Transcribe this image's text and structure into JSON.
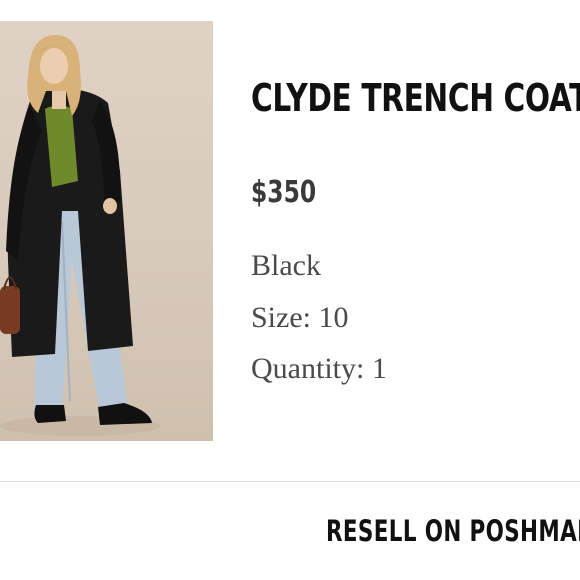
{
  "product": {
    "title": "CLYDE TRENCH COAT",
    "price": "$350",
    "color": "Black",
    "size": "Size: 10",
    "quantity": "Quantity: 1",
    "image_icon": "product-photo"
  },
  "actions": {
    "resell_label": "RESELL ON POSHMARK"
  }
}
